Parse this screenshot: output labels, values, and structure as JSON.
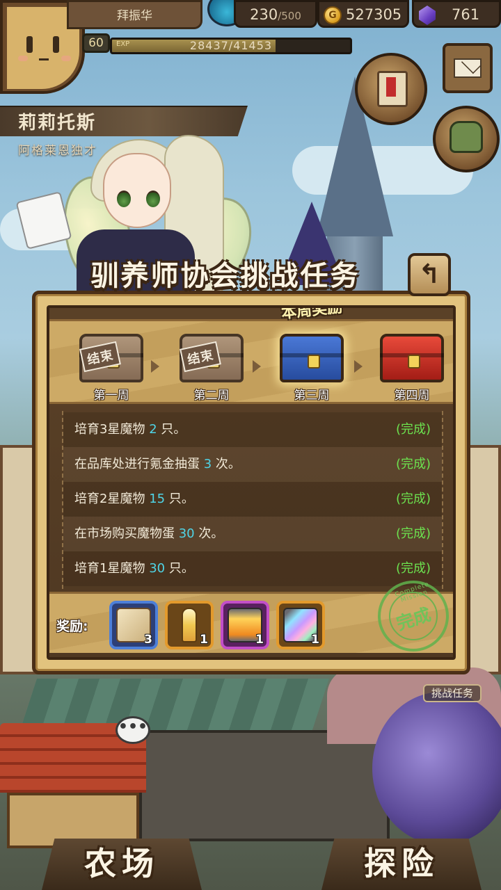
{
  "hud": {
    "player_name": "拜振华",
    "level": "60",
    "exp_label": "EXP",
    "exp_text": "28437/41453",
    "exp_fraction": 0.686,
    "stamina_current": "230",
    "stamina_max": "/500",
    "gold_symbol": "G",
    "gold": "527305",
    "gems": "761"
  },
  "character": {
    "name": "莉莉托斯",
    "subtitle": "阿格莱恩独才"
  },
  "panel": {
    "title": "驯养师协会挑战任务",
    "back_symbol": "↰",
    "this_week_badge": "本周奖励",
    "weeks": [
      {
        "label": "第一周",
        "state": "done",
        "stamp": "结束"
      },
      {
        "label": "第二周",
        "state": "done",
        "stamp": "结束"
      },
      {
        "label": "第三周",
        "state": "current",
        "stamp": ""
      },
      {
        "label": "第四周",
        "state": "locked",
        "stamp": ""
      }
    ],
    "tasks": [
      {
        "pre": "培育3星魔物 ",
        "num": "2",
        "post": " 只。",
        "status": "(完成)"
      },
      {
        "pre": "在品库处进行氪金抽蛋 ",
        "num": "3",
        "post": " 次。",
        "status": "(完成)"
      },
      {
        "pre": "培育2星魔物 ",
        "num": "15",
        "post": " 只。",
        "status": "(完成)"
      },
      {
        "pre": "在市场购买魔物蛋 ",
        "num": "30",
        "post": " 次。",
        "status": "(完成)"
      },
      {
        "pre": "培育1星魔物 ",
        "num": "30",
        "post": " 只。",
        "status": "(完成)"
      }
    ],
    "reward_label": "奖励:",
    "rewards": [
      {
        "icon": "scroll-ticket-icon",
        "count": "3",
        "frame_color": "#4d7fd8"
      },
      {
        "icon": "winged-potion-icon",
        "count": "1",
        "frame_color": "#e39a2c"
      },
      {
        "icon": "gold-capsule-icon",
        "count": "1",
        "frame_color": "#c24fc8"
      },
      {
        "icon": "rainbow-capsule-icon",
        "count": "1",
        "frame_color": "#e39a2c"
      }
    ],
    "complete_stamp": "完成",
    "complete_stamp_ring": "Complete Mission"
  },
  "side": {
    "task_button": "挑战任务"
  },
  "chat": {
    "bubble": "•••"
  },
  "nav": {
    "farm": "农场",
    "explore": "探险"
  },
  "colors": {
    "task_number": "#4fd4e6",
    "task_done": "#6ce24f",
    "panel_parchment": "#e2c37e",
    "panel_dark": "#4f3822"
  }
}
